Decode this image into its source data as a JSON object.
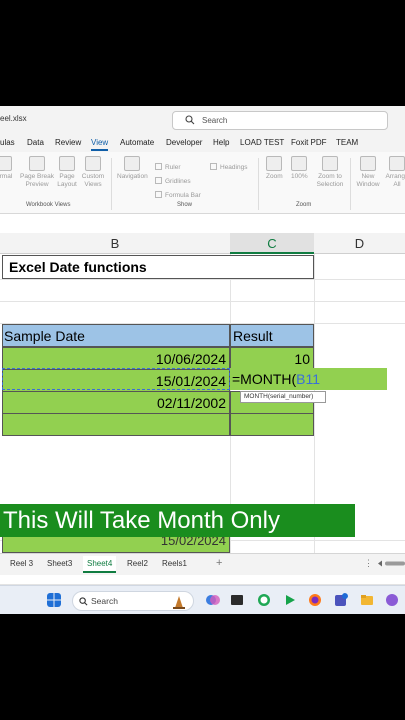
{
  "window": {
    "filename": "eel.xlsx"
  },
  "search": {
    "placeholder": "Search"
  },
  "ribbon_tabs": [
    "ulas",
    "Data",
    "Review",
    "View",
    "Automate",
    "Developer",
    "Help",
    "LOAD TEST",
    "Foxit PDF",
    "TEAM"
  ],
  "ribbon": {
    "workbook_views": [
      "ormal",
      "Page Break Preview",
      "Page Layout",
      "Custom Views"
    ],
    "navigation": "Navigation",
    "show_checks": [
      "Ruler",
      "Gridlines",
      "Formula Bar",
      "Headings"
    ],
    "zoom_buttons": [
      "Zoom",
      "100%",
      "Zoom to Selection"
    ],
    "window_buttons": [
      "New Window",
      "Arrange All"
    ],
    "groups": {
      "workbook_views": "Workbook Views",
      "show": "Show",
      "zoom": "Zoom"
    }
  },
  "columns": [
    "B",
    "C",
    "D"
  ],
  "sheet": {
    "title": "Excel Date functions",
    "header_b": "Sample Date",
    "header_c": "Result",
    "rows": [
      {
        "date": "10/06/2024",
        "result": "10"
      },
      {
        "date": "15/01/2024",
        "result": ""
      },
      {
        "date": "02/11/2002",
        "result": ""
      }
    ],
    "formula_prefix": "=MONTH(",
    "formula_ref": "B11",
    "tooltip": "MONTH(serial_number)",
    "partial_row": "15/02/2024"
  },
  "caption": "This Will Take Month Only",
  "sheet_tabs": [
    "Reel 3",
    "Sheet3",
    "Sheet4",
    "Reel2",
    "Reels1"
  ],
  "active_sheet": "Sheet4",
  "taskbar": {
    "search_label": "Search"
  },
  "colors": {
    "green_fill": "#92d050",
    "blue_header": "#9dc3e6",
    "caption_bg": "#1a8d1e",
    "excel_green": "#107c41"
  }
}
